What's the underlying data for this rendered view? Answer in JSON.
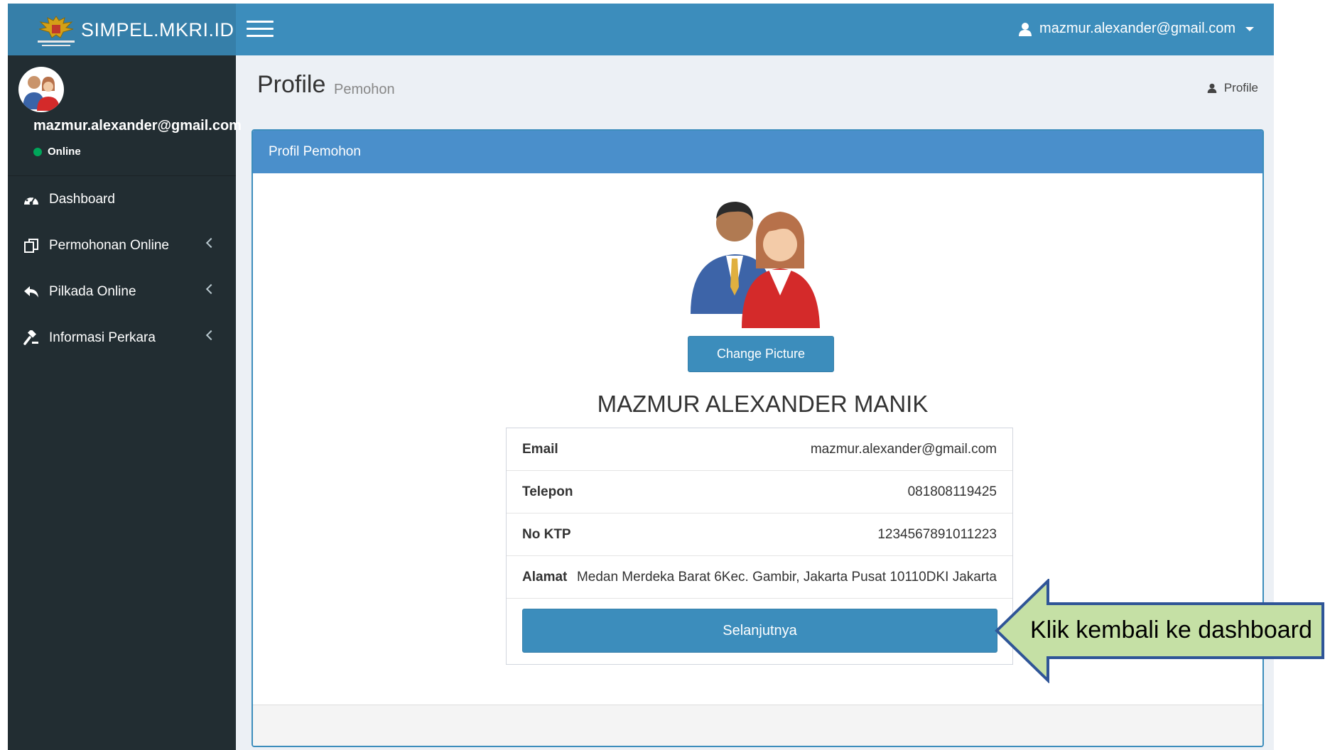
{
  "header": {
    "brand": "SIMPEL.MKRI.ID",
    "user_email": "mazmur.alexander@gmail.com"
  },
  "sidebar": {
    "user_email": "mazmur.alexander@gmail.com",
    "status": "Online",
    "items": [
      {
        "label": "Dashboard",
        "icon": "dashboard-icon"
      },
      {
        "label": "Permohonan Online",
        "icon": "copy-icon"
      },
      {
        "label": "Pilkada Online",
        "icon": "reply-icon"
      },
      {
        "label": "Informasi Perkara",
        "icon": "gavel-icon"
      }
    ]
  },
  "page": {
    "title": "Profile",
    "subtitle": "Pemohon",
    "breadcrumb": "Profile"
  },
  "box": {
    "title": "Profil Pemohon",
    "change_picture_label": "Change Picture",
    "name": "MAZMUR ALEXANDER MANIK",
    "fields": [
      {
        "label": "Email",
        "value": "mazmur.alexander@gmail.com"
      },
      {
        "label": "Telepon",
        "value": "081808119425"
      },
      {
        "label": "No KTP",
        "value": "1234567891011223"
      },
      {
        "label": "Alamat",
        "value": "Medan Merdeka Barat 6Kec. Gambir, Jakarta Pusat 10110DKI Jakarta"
      }
    ],
    "next_label": "Selanjutnya"
  },
  "callout": {
    "text": "Klik kembali ke dashboard",
    "fill_color": "#c5e0a5",
    "border_color": "#2f5597"
  },
  "colors": {
    "primary": "#3c8dbc",
    "sidebar": "#222d32",
    "online": "#00a65a"
  }
}
